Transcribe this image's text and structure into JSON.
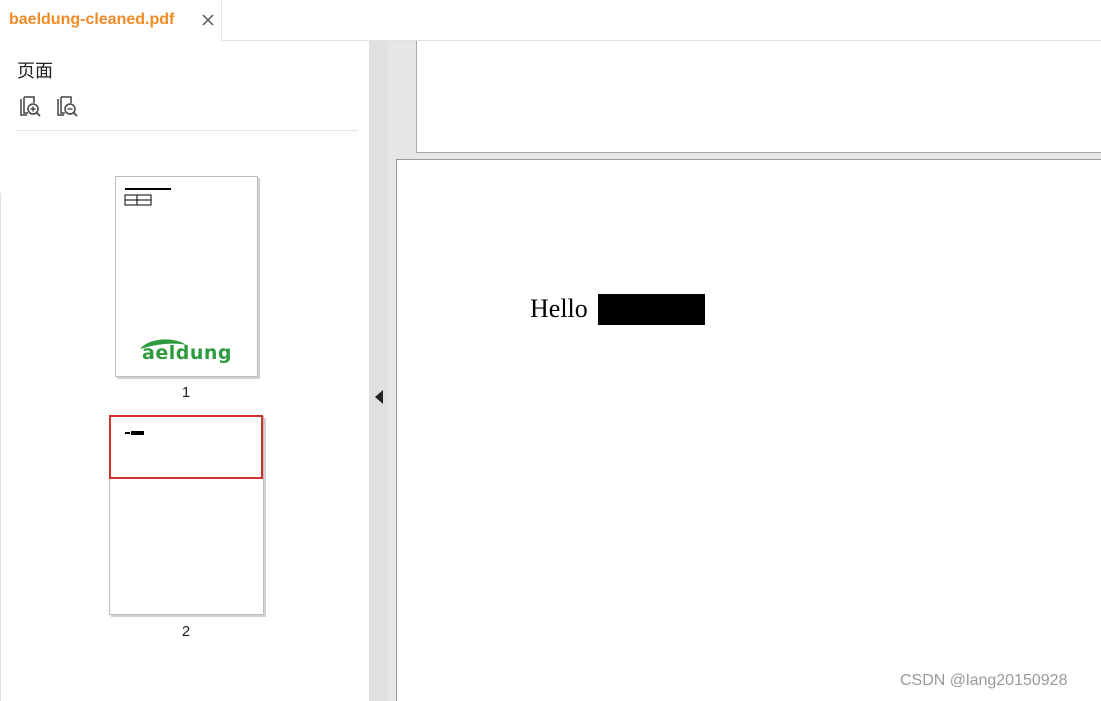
{
  "tabs": [
    {
      "label": "baeldung-cleaned.pdf",
      "active": true,
      "color": "#f08a24",
      "close_icon": "close-icon"
    }
  ],
  "sidebar": {
    "title": "页面",
    "tools": [
      {
        "name": "zoom-in-pages",
        "icon": "pages-zoom-in-icon"
      },
      {
        "name": "zoom-out-pages",
        "icon": "pages-zoom-out-icon"
      }
    ],
    "thumbnails": [
      {
        "page": "1",
        "logo_text": "aeldung",
        "logo_color": "#2e9a3e"
      },
      {
        "page": "2",
        "selected": true,
        "highlight_color": "#d32f2f"
      }
    ],
    "collapse_icon": "triangle-left-icon"
  },
  "document": {
    "text": "Hello",
    "redaction_color": "#000000"
  },
  "watermark": "CSDN @lang20150928"
}
